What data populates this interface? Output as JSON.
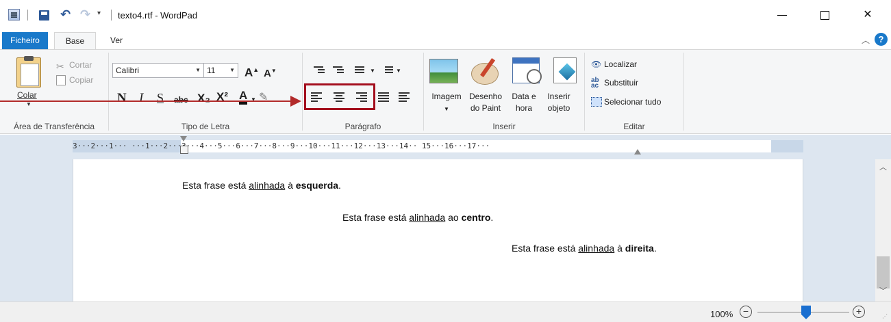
{
  "window": {
    "title": "texto4.rtf - WordPad",
    "minimize_glyph": "",
    "maximize_glyph": "",
    "close_glyph": "✕"
  },
  "quick_access": {
    "undo_glyph": "↶",
    "redo_glyph": "↷",
    "dropdown_glyph": "▾"
  },
  "tabs": [
    {
      "label": "Ficheiro"
    },
    {
      "label": "Base"
    },
    {
      "label": "Ver"
    }
  ],
  "ribbon": {
    "clipboard": {
      "group_label": "Área de Transferência",
      "paste_label": "Colar",
      "cut_label": "Cortar",
      "copy_label": "Copiar"
    },
    "font": {
      "group_label": "Tipo de Letra",
      "family": "Calibri",
      "size": "11",
      "grow_glyph": "A",
      "shrink_glyph": "A",
      "bold_glyph": "N",
      "italic_glyph": "I",
      "underline_glyph": "S",
      "strike_glyph": "abc",
      "subscript_glyph": "X₂",
      "superscript_glyph": "X²",
      "color_glyph": "A",
      "highlight_glyph": "✎"
    },
    "paragraph": {
      "group_label": "Parágrafo"
    },
    "insert": {
      "group_label": "Inserir",
      "image_label": "Imagem",
      "paint_label_1": "Desenho",
      "paint_label_2": "do Paint",
      "datetime_label_1": "Data e",
      "datetime_label_2": "hora",
      "object_label_1": "Inserir",
      "object_label_2": "objeto"
    },
    "edit": {
      "group_label": "Editar",
      "find_label": "Localizar",
      "replace_label": "Substituir",
      "select_all_label": "Selecionar tudo"
    }
  },
  "ruler": {
    "text": "3···2···1···  ···1···2···3···4···5···6···7···8···9···10···11···12···13···14··  15···16···17···"
  },
  "document": {
    "line1": {
      "pre": "Esta frase está ",
      "u": "alinhada",
      "mid": " à ",
      "b": "esquerda",
      "post": "."
    },
    "line2": {
      "pre": "Esta frase está ",
      "u": "alinhada",
      "mid": " ao ",
      "b": "centro",
      "post": "."
    },
    "line3": {
      "pre": "Esta frase está ",
      "u": "alinhada",
      "mid": " à ",
      "b": "direita",
      "post": "."
    }
  },
  "status": {
    "zoom": "100%",
    "zoom_out_glyph": "−",
    "zoom_in_glyph": "+"
  },
  "colors": {
    "accent": "#1979ca",
    "highlight_box": "#a30d1d",
    "arrow": "#b22a2a"
  }
}
